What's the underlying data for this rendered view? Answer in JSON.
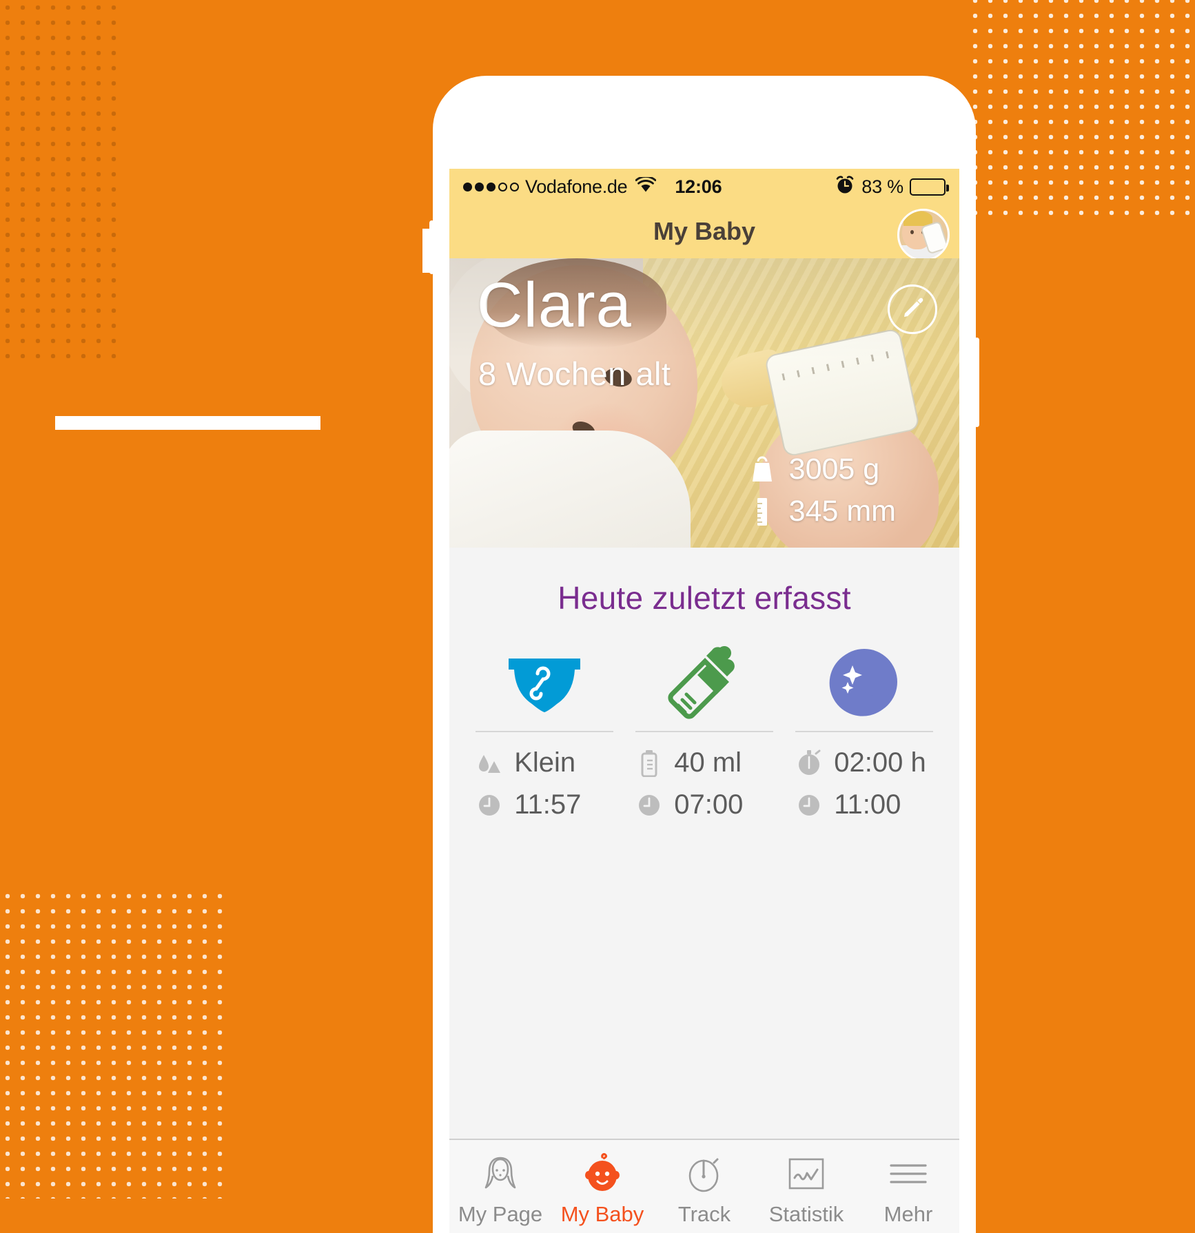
{
  "status_bar": {
    "signal_dots_filled": 3,
    "signal_dots_total": 5,
    "carrier": "Vodafone.de",
    "wifi_icon": "wifi-icon",
    "time": "12:06",
    "alarm_icon": "alarm-clock-icon",
    "battery_percent": "83 %",
    "battery_fill": 83
  },
  "navbar": {
    "title": "My Baby",
    "avatar_name": "baby-avatar"
  },
  "hero": {
    "name": "Clara",
    "age": "8 Wochen alt",
    "edit_icon": "pencil-edit-icon",
    "stats": [
      {
        "icon": "weight-scale-icon",
        "value": "3005 g"
      },
      {
        "icon": "ruler-height-icon",
        "value": "345 mm"
      }
    ]
  },
  "today": {
    "title": "Heute zuletzt erfasst",
    "tiles": [
      {
        "icon": "diaper-icon",
        "icon_color": "#029BD6",
        "lines": [
          {
            "icon": "drop-size-icon",
            "text": "Klein"
          },
          {
            "icon": "clock-icon",
            "text": "11:57"
          }
        ]
      },
      {
        "icon": "baby-bottle-icon",
        "icon_color": "#4C9A4C",
        "lines": [
          {
            "icon": "bottle-amount-icon",
            "text": "40 ml"
          },
          {
            "icon": "clock-icon",
            "text": "07:00"
          }
        ]
      },
      {
        "icon": "moon-sleep-icon",
        "icon_color": "#6F7CC9",
        "lines": [
          {
            "icon": "stopwatch-icon",
            "text": "02:00 h"
          },
          {
            "icon": "clock-icon",
            "text": "11:00"
          }
        ]
      }
    ]
  },
  "tabbar": {
    "active_index": 1,
    "accent_color": "#F4511E",
    "tabs": [
      {
        "icon": "mother-profile-icon",
        "label": "My Page"
      },
      {
        "icon": "baby-face-icon",
        "label": "My Baby"
      },
      {
        "icon": "stopwatch-icon",
        "label": "Track"
      },
      {
        "icon": "chart-line-icon",
        "label": "Statistik"
      },
      {
        "icon": "hamburger-menu-icon",
        "label": "Mehr"
      }
    ]
  },
  "background": {
    "accent": "#EE7F0E"
  }
}
